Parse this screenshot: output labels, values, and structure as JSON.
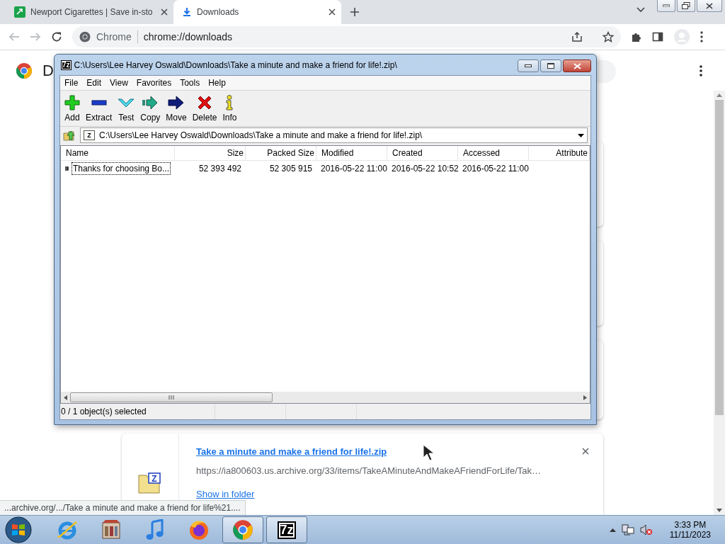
{
  "tabs": [
    {
      "title": "Newport Cigarettes | Save in-sto",
      "selected": false,
      "kind": "site"
    },
    {
      "title": "Downloads",
      "selected": true,
      "kind": "downloads"
    }
  ],
  "address": {
    "site": "Chrome",
    "url": "chrome://downloads"
  },
  "page": {
    "title": "D"
  },
  "zip_window": {
    "icon_text": "7z",
    "title": "C:\\Users\\Lee Harvey Oswald\\Downloads\\Take a minute and make a friend for life!.zip\\",
    "menu": [
      "File",
      "Edit",
      "View",
      "Favorites",
      "Tools",
      "Help"
    ],
    "tools": [
      {
        "label": "Add",
        "kind": "add"
      },
      {
        "label": "Extract",
        "kind": "extract"
      },
      {
        "label": "Test",
        "kind": "test"
      },
      {
        "label": "Copy",
        "kind": "copy"
      },
      {
        "label": "Move",
        "kind": "move"
      },
      {
        "label": "Delete",
        "kind": "delete"
      },
      {
        "label": "Info",
        "kind": "info"
      }
    ],
    "path_icon_text": "Z",
    "path": "C:\\Users\\Lee Harvey Oswald\\Downloads\\Take a minute and make a friend for life!.zip\\",
    "columns": [
      "Name",
      "Size",
      "Packed Size",
      "Modified",
      "Created",
      "Accessed",
      "Attribute"
    ],
    "rows": [
      {
        "cells": [
          "Thanks for choosing Bo...",
          "52 393 492",
          "52 305 915",
          "2016-05-22 11:00",
          "2016-05-22 10:52",
          "2016-05-22 11:00"
        ]
      }
    ],
    "status": "0 / 1 object(s) selected"
  },
  "download": {
    "icon_text": "Z",
    "name": "Take a minute and make a friend for life!.zip",
    "url": "https://ia800603.us.archive.org/33/items/TakeAMinuteAndMakeAFriendForLife/Tak…",
    "action": "Show in folder"
  },
  "link_status": "...archive.org/.../Take a minute and make a friend for life%21....",
  "taskbar": {
    "apps": [
      {
        "kind": "ie",
        "open": false
      },
      {
        "kind": "archive",
        "open": false
      },
      {
        "kind": "music",
        "open": false
      },
      {
        "kind": "firefox",
        "open": false
      },
      {
        "kind": "chrome",
        "open": true
      },
      {
        "kind": "sevenzip",
        "open": true,
        "label": "7z"
      }
    ],
    "time": "3:33 PM",
    "date": "11/11/2023"
  }
}
